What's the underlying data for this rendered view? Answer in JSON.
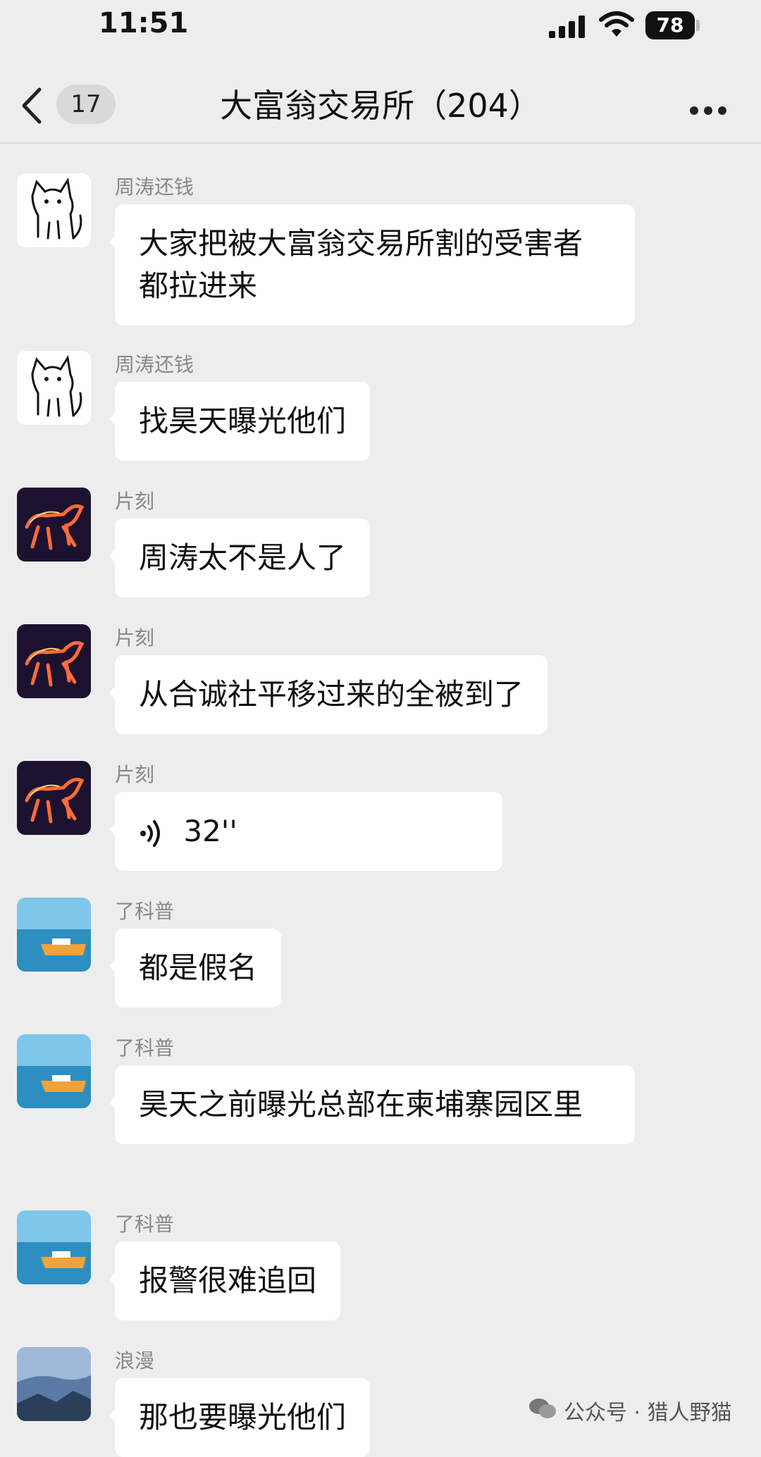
{
  "status_bar": {
    "time": "11:51",
    "battery": "78"
  },
  "header": {
    "back_icon": "chevron-left-icon",
    "unread_count": "17",
    "title": "大富翁交易所（204）",
    "more_icon": "ellipsis-icon"
  },
  "messages": [
    {
      "sender": "周涛还钱",
      "text": "大家把被大富翁交易所割的受害者都拉进来",
      "avatar": "cat-sketch"
    },
    {
      "sender": "周涛还钱",
      "text": "找昊天曝光他们",
      "avatar": "cat-sketch"
    },
    {
      "sender": "片刻",
      "text": "周涛太不是人了",
      "avatar": "fire-horse"
    },
    {
      "sender": "片刻",
      "text": "从合诚社平移过来的全被到了",
      "avatar": "fire-horse"
    },
    {
      "sender": "片刻",
      "voice_duration": "32''",
      "avatar": "fire-horse"
    },
    {
      "sender": "了科普",
      "text": "都是假名",
      "avatar": "boat-sea"
    },
    {
      "sender": "了科普",
      "text": "昊天之前曝光总部在柬埔寨园区里",
      "avatar": "boat-sea"
    },
    {
      "sender": "了科普",
      "text": "报警很难追回",
      "avatar": "boat-sea"
    },
    {
      "sender": "浪漫",
      "text": "那也要曝光他们",
      "avatar": "sky-landscape"
    }
  ],
  "watermark": {
    "text": "公众号 · 猎人野猫"
  }
}
